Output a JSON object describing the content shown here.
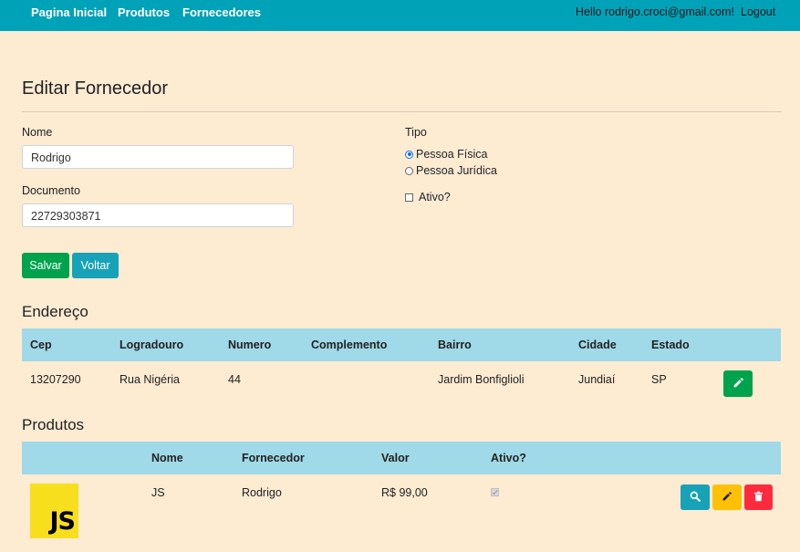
{
  "nav": {
    "home": "Pagina Inicial",
    "products": "Produtos",
    "suppliers": "Fornecedores",
    "greeting": "Hello rodrigo.croci@gmail.com!",
    "logout": "Logout"
  },
  "form": {
    "title": "Editar Fornecedor",
    "name_label": "Nome",
    "name_value": "Rodrigo",
    "document_label": "Documento",
    "document_value": "22729303871",
    "type_label": "Tipo",
    "type_options": [
      "Pessoa Física",
      "Pessoa Jurídica"
    ],
    "type_selected": "Pessoa Física",
    "active_label": "Ativo?",
    "active_checked": false,
    "save_label": "Salvar",
    "back_label": "Voltar"
  },
  "address": {
    "title": "Endereço",
    "columns": [
      "Cep",
      "Logradouro",
      "Numero",
      "Complemento",
      "Bairro",
      "Cidade",
      "Estado"
    ],
    "row": {
      "cep": "13207290",
      "logradouro": "Rua Nigéria",
      "numero": "44",
      "complemento": "",
      "bairro": "Jardim Bonfiglioli",
      "cidade": "Jundiaí",
      "estado": "SP"
    }
  },
  "products": {
    "title": "Produtos",
    "columns": [
      "Nome",
      "Fornecedor",
      "Valor",
      "Ativo?"
    ],
    "row": {
      "image_text": "JS",
      "nome": "JS",
      "fornecedor": "Rodrigo",
      "valor": "R$ 99,00",
      "ativo": true
    }
  },
  "icons": {
    "edit": "pencil-icon",
    "view": "search-icon",
    "delete": "trash-icon"
  },
  "colors": {
    "navbar": "#00a2b8",
    "background": "#fdebd2",
    "table_header": "#a0d9e8",
    "success": "#00a34d",
    "info": "#17a2b8",
    "warning": "#ffc107",
    "danger": "#ff2a3d"
  }
}
